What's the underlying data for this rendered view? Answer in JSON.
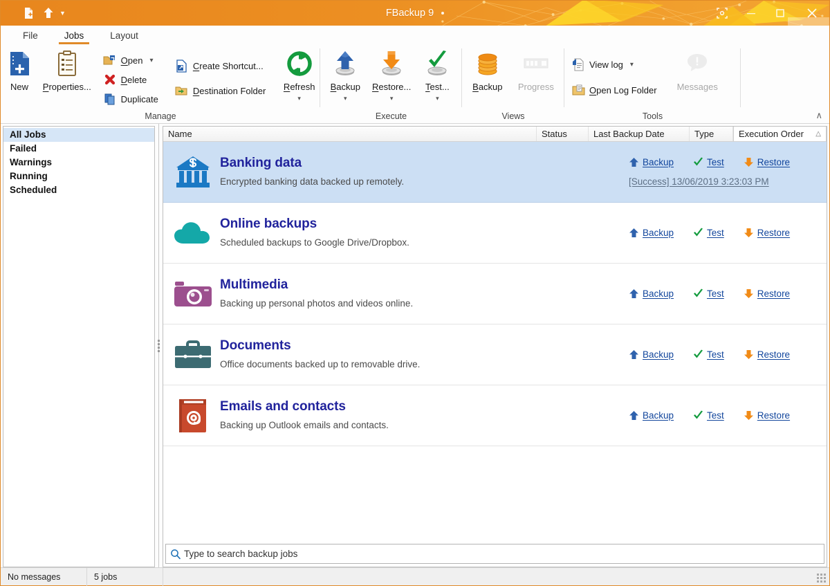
{
  "window": {
    "title": "FBackup 9",
    "modified_dot": "•",
    "quick_access": [
      {
        "name": "new-job-icon",
        "label": "New"
      },
      {
        "name": "backup-up-icon",
        "label": "Backup"
      },
      {
        "name": "qat-dropdown-icon",
        "label": "Customize Quick Access Toolbar"
      }
    ],
    "controls": [
      {
        "name": "capture-button",
        "glyph": "⌧"
      },
      {
        "name": "minimize-button",
        "glyph": "─"
      },
      {
        "name": "maximize-button",
        "glyph": "□"
      },
      {
        "name": "close-button",
        "glyph": "✕"
      }
    ]
  },
  "ribbon": {
    "tabs": [
      {
        "label": "File",
        "active": false
      },
      {
        "label": "Jobs",
        "active": true
      },
      {
        "label": "Layout",
        "active": false
      }
    ],
    "collapse_glyph": "∧",
    "groups": [
      {
        "label": "Manage",
        "large": [
          {
            "label": "New",
            "icon": "new-document-icon",
            "disabled": false
          },
          {
            "label": "Properties...",
            "icon": "clipboard-icon",
            "disabled": false
          }
        ],
        "small": [
          {
            "label": "Open",
            "icon": "open-folder-icon",
            "has_caret": true
          },
          {
            "label": "Delete",
            "icon": "red-x-icon",
            "has_caret": false
          },
          {
            "label": "Duplicate",
            "icon": "duplicate-icon",
            "has_caret": false
          },
          {
            "label": "Create Shortcut...",
            "icon": "shortcut-icon",
            "has_caret": false
          },
          {
            "label": "Destination Folder",
            "icon": "destination-folder-icon",
            "has_caret": false
          }
        ],
        "large_after": [
          {
            "label": "Refresh",
            "icon": "refresh-icon",
            "caret": "⌄",
            "disabled": false
          }
        ]
      },
      {
        "label": "Execute",
        "large": [
          {
            "label": "Backup",
            "icon": "backup-arrow-up-icon",
            "caret": "⌄",
            "disabled": false
          },
          {
            "label": "Restore...",
            "icon": "restore-arrow-down-icon",
            "caret": "⌄",
            "disabled": false
          },
          {
            "label": "Test...",
            "icon": "test-check-icon",
            "caret": "⌄",
            "disabled": false
          }
        ]
      },
      {
        "label": "Views",
        "large": [
          {
            "label": "Backup",
            "icon": "backup-stack-icon",
            "disabled": false
          },
          {
            "label": "Progress",
            "icon": "progress-bar-icon",
            "disabled": true
          }
        ]
      },
      {
        "label": "Tools",
        "small": [
          {
            "label": "View log",
            "icon": "view-log-icon",
            "has_caret": true
          },
          {
            "label": "Open Log Folder",
            "icon": "open-log-folder-icon",
            "has_caret": false
          }
        ],
        "large": [
          {
            "label": "Messages",
            "icon": "messages-icon",
            "disabled": true
          }
        ]
      }
    ]
  },
  "sidebar": {
    "items": [
      {
        "label": "All Jobs",
        "selected": true
      },
      {
        "label": "Failed",
        "selected": false
      },
      {
        "label": "Warnings",
        "selected": false
      },
      {
        "label": "Running",
        "selected": false
      },
      {
        "label": "Scheduled",
        "selected": false
      }
    ]
  },
  "list": {
    "columns": [
      {
        "label": "Name",
        "sorted": false
      },
      {
        "label": "Status",
        "sorted": false
      },
      {
        "label": "Last Backup Date",
        "sorted": false
      },
      {
        "label": "Type",
        "sorted": false
      },
      {
        "label": "Execution Order",
        "sorted": true,
        "sort_glyph": "△"
      }
    ],
    "actions": {
      "backup": "Backup",
      "test": "Test",
      "restore": "Restore"
    },
    "rows": [
      {
        "name": "Banking data",
        "description": "Encrypted banking data backed up remotely.",
        "icon": "bank-icon",
        "selected": true,
        "status": "[Success] 13/06/2019 3:23:03 PM"
      },
      {
        "name": "Online backups",
        "description": "Scheduled backups to Google Drive/Dropbox.",
        "icon": "cloud-icon",
        "selected": false,
        "status": ""
      },
      {
        "name": "Multimedia",
        "description": "Backing up personal photos and videos online.",
        "icon": "camera-icon",
        "selected": false,
        "status": ""
      },
      {
        "name": "Documents",
        "description": "Office documents backed up to removable drive.",
        "icon": "briefcase-icon",
        "selected": false,
        "status": ""
      },
      {
        "name": "Emails and contacts",
        "description": "Backing up Outlook emails and contacts.",
        "icon": "email-book-icon",
        "selected": false,
        "status": ""
      }
    ]
  },
  "search": {
    "placeholder": "Type to search backup jobs",
    "value": "",
    "icon": "search-icon"
  },
  "statusbar": {
    "messages": "No messages",
    "jobs_count": "5 jobs"
  },
  "colors": {
    "titlebar": "#e8861d",
    "accent": "#e08a28",
    "job_name": "#21239c",
    "link": "#11459c",
    "selection": "#ccdff4",
    "sidebar_selection": "#d6e6f7"
  }
}
